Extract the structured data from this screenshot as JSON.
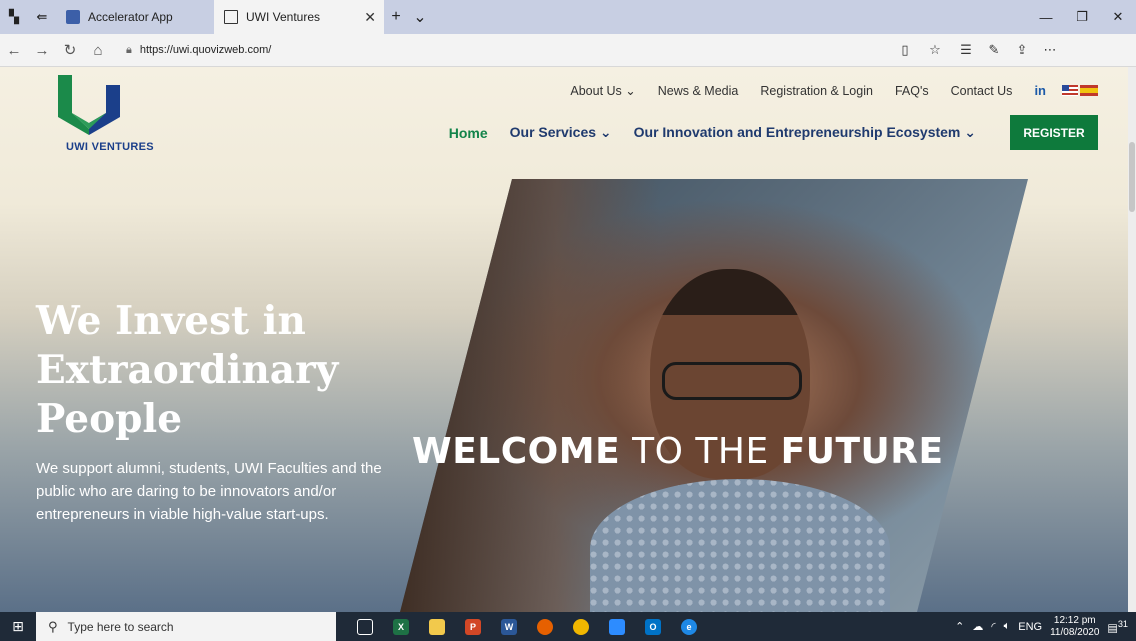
{
  "browser": {
    "tabs": [
      {
        "title": "Accelerator App",
        "active": false
      },
      {
        "title": "UWI Ventures",
        "active": true
      }
    ],
    "url": "https://uwi.quovizweb.com/"
  },
  "site": {
    "logo_text": "UWI VENTURES",
    "top_nav": [
      "About Us",
      "News & Media",
      "Registration & Login",
      "FAQ's",
      "Contact Us"
    ],
    "linkedin": "in",
    "main_nav": {
      "home": "Home",
      "services": "Our Services",
      "ecosystem": "Our Innovation and Entrepreneurship Ecosystem",
      "register": "REGISTER"
    },
    "hero": {
      "title_line1": "We Invest in",
      "title_line2": "Extraordinary",
      "title_line3": "People",
      "subtitle": "We support alumni, students, UWI Faculties and the public who are daring to be innovators and/or entrepreneurs in viable high-value start-ups.",
      "welcome_bold1": "WELCOME",
      "welcome_mid": "TO THE",
      "welcome_bold2": "FUTURE"
    },
    "colors": {
      "brand_green": "#0e7a3c",
      "brand_blue": "#1b3f8a"
    }
  },
  "taskbar": {
    "search_placeholder": "Type here to search",
    "lang": "ENG",
    "time": "12:12 pm",
    "date": "11/08/2020",
    "notification_count": "31"
  }
}
